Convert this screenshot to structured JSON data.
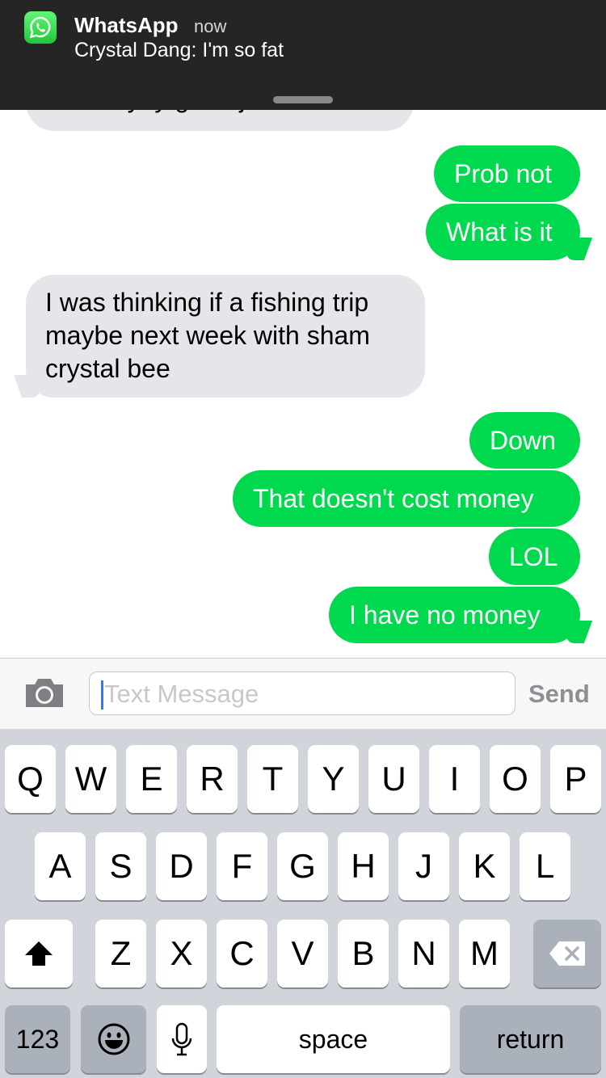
{
  "notification": {
    "app": "WhatsApp",
    "time": "now",
    "message": "Crystal Dang: I'm so fat",
    "icon": "whatsapp-icon"
  },
  "messages": [
    {
      "dir": "in",
      "text": "before yoy get a job?",
      "partial": true
    },
    {
      "dir": "out",
      "text": "Prob not"
    },
    {
      "dir": "out",
      "text": "What is it"
    },
    {
      "dir": "in",
      "lines": [
        "I was thinking if a fishing trip",
        "maybe next week with sham",
        "crystal bee"
      ]
    },
    {
      "dir": "out",
      "text": "Down"
    },
    {
      "dir": "out",
      "text": "That doesn't cost money"
    },
    {
      "dir": "out",
      "text": "LOL"
    },
    {
      "dir": "out",
      "text": "I have no money"
    }
  ],
  "input": {
    "placeholder": "Text Message",
    "send_label": "Send",
    "camera_icon": "camera-icon"
  },
  "keyboard": {
    "row1": [
      "Q",
      "W",
      "E",
      "R",
      "T",
      "Y",
      "U",
      "I",
      "O",
      "P"
    ],
    "row2": [
      "A",
      "S",
      "D",
      "F",
      "G",
      "H",
      "J",
      "K",
      "L"
    ],
    "row3": [
      "Z",
      "X",
      "C",
      "V",
      "B",
      "N",
      "M"
    ],
    "shift_icon": "shift-icon",
    "delete_icon": "delete-icon",
    "numbers_label": "123",
    "emoji_icon": "emoji-icon",
    "mic_icon": "microphone-icon",
    "space_label": "space",
    "return_label": "return"
  }
}
